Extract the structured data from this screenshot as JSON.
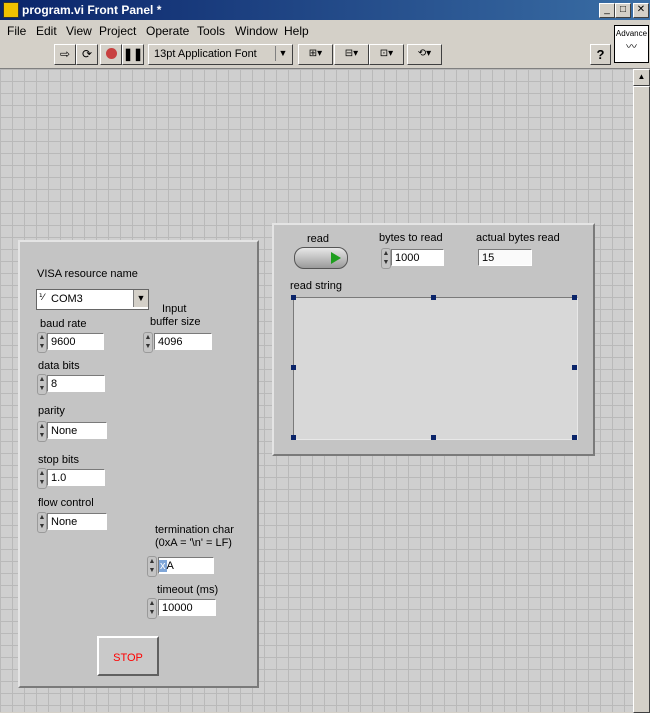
{
  "window": {
    "title": "program.vi Front Panel *"
  },
  "menu": {
    "items": [
      "File",
      "Edit",
      "View",
      "Project",
      "Operate",
      "Tools",
      "Window",
      "Help"
    ]
  },
  "toolbar": {
    "font_select": "13pt Application Font",
    "help": "?",
    "advance_label": "Advance"
  },
  "config_panel": {
    "visa_label": "VISA resource name",
    "visa_value": "COM3",
    "baud_label": "baud rate",
    "baud_value": "9600",
    "buffer_label_line1": "Input",
    "buffer_label_line2": "buffer size",
    "buffer_value": "4096",
    "databits_label": "data bits",
    "databits_value": "8",
    "parity_label": "parity",
    "parity_value": "None",
    "stopbits_label": "stop bits",
    "stopbits_value": "1.0",
    "flow_label": "flow control",
    "flow_value": "None",
    "term_label_line1": "termination char",
    "term_label_line2": "(0xA = '\\n' = LF)",
    "term_prefix": "x",
    "term_value": "A",
    "timeout_label": "timeout (ms)",
    "timeout_value": "10000",
    "stop_label": "STOP"
  },
  "read_panel": {
    "read_label": "read",
    "bytes_label": "bytes to read",
    "bytes_value": "1000",
    "actual_label": "actual bytes read",
    "actual_value": "15",
    "string_label": "read string",
    "string_value": ""
  }
}
